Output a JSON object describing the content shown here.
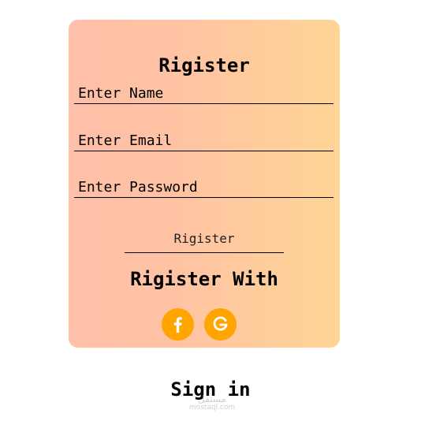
{
  "form": {
    "title": "Rigister",
    "name_placeholder": "Enter Name",
    "email_placeholder": "Enter Email",
    "password_placeholder": "Enter Password",
    "submit_label": "Rigister",
    "register_with_label": "Rigister With"
  },
  "social": {
    "facebook_icon": "facebook-icon",
    "google_icon": "google-icon",
    "button_color": "#ffa500"
  },
  "footer": {
    "signin_label": "Sign in"
  },
  "watermark": {
    "text": "مستقل",
    "url_text": "mostaql.com"
  }
}
